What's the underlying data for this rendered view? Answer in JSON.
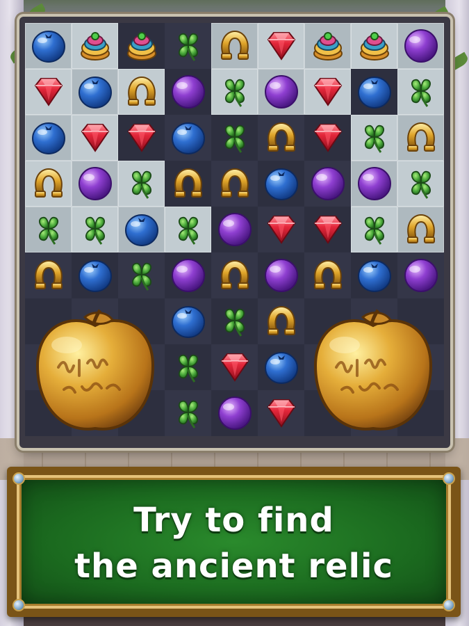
{
  "banner": {
    "line1": "Try to find",
    "line2": "the ancient relic"
  },
  "relic": {
    "name": "golden-apple-relic",
    "count": 2
  },
  "board": {
    "columns": 9,
    "rows": 9,
    "colors": {
      "blueberry": "#2f6fd1",
      "ruby": "#e3263a",
      "horseshoe": "#e0a52a",
      "clover": "#49a83a",
      "grape": "#8f3fd1",
      "cupcake": "#e2b13a",
      "relic": "#d9a233"
    },
    "cells": [
      [
        "blueberry",
        "cupcake",
        "cupcake",
        "clover",
        "horseshoe",
        "ruby",
        "cupcake",
        "cupcake",
        "grape"
      ],
      [
        "ruby",
        "blueberry",
        "horseshoe",
        "grape",
        "clover",
        "grape",
        "ruby",
        "blueberry",
        "clover"
      ],
      [
        "blueberry",
        "ruby",
        "ruby",
        "blueberry",
        "clover",
        "horseshoe",
        "ruby",
        "clover",
        "horseshoe"
      ],
      [
        "horseshoe",
        "grape",
        "clover",
        "horseshoe",
        "horseshoe",
        "blueberry",
        "grape",
        "grape",
        "clover"
      ],
      [
        "clover",
        "clover",
        "blueberry",
        "clover",
        "grape",
        "ruby",
        "ruby",
        "clover",
        "horseshoe"
      ],
      [
        "horseshoe",
        "blueberry",
        "clover",
        "grape",
        "horseshoe",
        "grape",
        "horseshoe",
        "blueberry",
        "grape"
      ],
      [
        "relic",
        "relic",
        "relic",
        "blueberry",
        "clover",
        "horseshoe",
        "relic",
        "relic",
        "relic"
      ],
      [
        "relic",
        "relic",
        "relic",
        "clover",
        "ruby",
        "blueberry",
        "relic",
        "relic",
        "relic"
      ],
      [
        "relic",
        "relic",
        "relic",
        "clover",
        "grape",
        "ruby",
        "relic",
        "relic",
        "relic"
      ]
    ],
    "blocked": [
      [
        1,
        1,
        0,
        0,
        1,
        1,
        1,
        1,
        1
      ],
      [
        1,
        1,
        1,
        0,
        1,
        1,
        1,
        0,
        1
      ],
      [
        1,
        1,
        0,
        0,
        0,
        0,
        0,
        1,
        1
      ],
      [
        1,
        1,
        1,
        0,
        0,
        0,
        0,
        1,
        1
      ],
      [
        1,
        1,
        1,
        1,
        0,
        0,
        0,
        1,
        1
      ],
      [
        0,
        0,
        0,
        0,
        0,
        0,
        0,
        0,
        0
      ],
      [
        0,
        0,
        0,
        0,
        0,
        0,
        0,
        0,
        0
      ],
      [
        0,
        0,
        0,
        0,
        0,
        0,
        0,
        0,
        0
      ],
      [
        0,
        0,
        0,
        0,
        0,
        0,
        0,
        0,
        0
      ]
    ]
  }
}
